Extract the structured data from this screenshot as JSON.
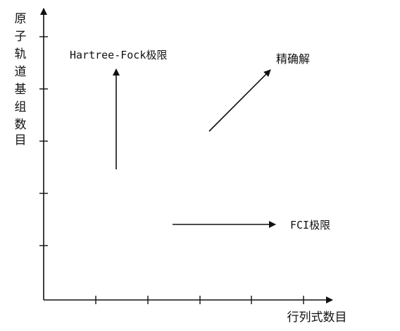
{
  "diagram": {
    "y_axis_label": [
      "原",
      "子",
      "轨",
      "道",
      "基",
      "组",
      "数",
      "目"
    ],
    "x_axis_label": "行列式数目",
    "labels": {
      "hartree_fock_prefix": "Hartree-Fock",
      "hartree_fock_suffix": "极限",
      "exact": "精确解",
      "fci_prefix": "FCI",
      "fci_suffix": "极限"
    },
    "x_tick_count": 5,
    "y_tick_count": 5
  }
}
